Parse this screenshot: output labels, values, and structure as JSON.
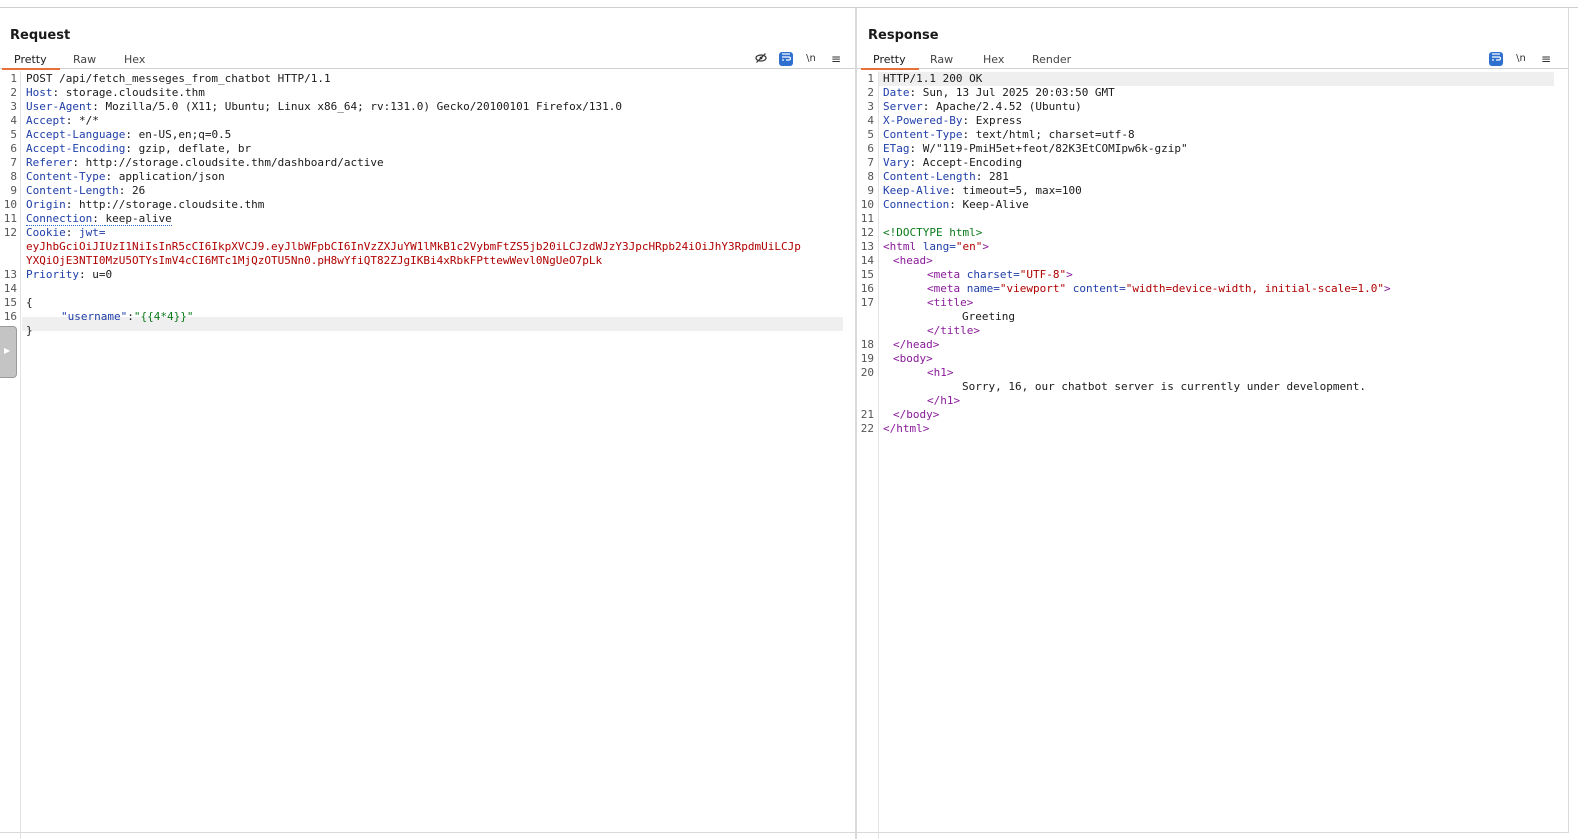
{
  "request": {
    "title": "Request",
    "tabs": [
      "Pretty",
      "Raw",
      "Hex"
    ],
    "line_numbers": [
      "1",
      "2",
      "3",
      "4",
      "5",
      "6",
      "7",
      "8",
      "9",
      "10",
      "11",
      "12",
      "13",
      "14",
      "15",
      "16"
    ],
    "request_line": "POST /api/fetch_messeges_from_chatbot HTTP/1.1",
    "headers": [
      {
        "name": "Host",
        "value": "storage.cloudsite.thm"
      },
      {
        "name": "User-Agent",
        "value": "Mozilla/5.0 (X11; Ubuntu; Linux x86_64; rv:131.0) Gecko/20100101 Firefox/131.0"
      },
      {
        "name": "Accept",
        "value": "*/*"
      },
      {
        "name": "Accept-Language",
        "value": "en-US,en;q=0.5"
      },
      {
        "name": "Accept-Encoding",
        "value": "gzip, deflate, br"
      },
      {
        "name": "Referer",
        "value": "http://storage.cloudsite.thm/dashboard/active"
      },
      {
        "name": "Content-Type",
        "value": "application/json"
      },
      {
        "name": "Content-Length",
        "value": "26"
      },
      {
        "name": "Origin",
        "value": "http://storage.cloudsite.thm"
      },
      {
        "name": "Connection",
        "value": "keep-alive"
      }
    ],
    "cookie_name": "Cookie",
    "cookie_key": "jwt=",
    "cookie_line1": "eyJhbGciOiJIUzI1NiIsInR5cCI6IkpXVCJ9.eyJlbWFpbCI6InVzZXJuYW1lMkB1c2VybmFtZS5jb20iLCJzdWJzY3JpcHRpb24iOiJhY3RpdmUiLCJp",
    "cookie_line2": "YXQiOjE3NTI0MzU5OTYsImV4cCI6MTc1MjQzOTU5Nn0.pH8wYfiQT82ZJgIKBi4xRbkFPttewWevl0NgUeO7pLk",
    "priority_name": "Priority",
    "priority_value": "u=0",
    "body_open": "{",
    "body_key": "\"username\"",
    "body_colon": ":",
    "body_value": "\"{{4*4}}\"",
    "body_close": "}"
  },
  "response": {
    "title": "Response",
    "tabs": [
      "Pretty",
      "Raw",
      "Hex",
      "Render"
    ],
    "line_numbers": [
      "1",
      "2",
      "3",
      "4",
      "5",
      "6",
      "7",
      "8",
      "9",
      "10",
      "11",
      "12",
      "13",
      "14",
      "15",
      "16",
      "17",
      "18",
      "19",
      "20",
      "21",
      "22"
    ],
    "status_line": "HTTP/1.1 200 OK",
    "headers": [
      {
        "name": "Date",
        "value": "Sun, 13 Jul 2025 20:03:50 GMT"
      },
      {
        "name": "Server",
        "value": "Apache/2.4.52 (Ubuntu)"
      },
      {
        "name": "X-Powered-By",
        "value": "Express"
      },
      {
        "name": "Content-Type",
        "value": "text/html; charset=utf-8"
      },
      {
        "name": "ETag",
        "value": "W/\"119-PmiH5et+feot/82K3EtCOMIpw6k-gzip\""
      },
      {
        "name": "Vary",
        "value": "Accept-Encoding"
      },
      {
        "name": "Content-Length",
        "value": "281"
      },
      {
        "name": "Keep-Alive",
        "value": "timeout=5, max=100"
      },
      {
        "name": "Connection",
        "value": "Keep-Alive"
      }
    ],
    "html": {
      "doctype": "<!DOCTYPE html>",
      "html_open_tag": "<html",
      "lang_attr": "lang=",
      "lang_val": "\"en\"",
      "close_gt": ">",
      "head_open": "<head>",
      "meta_tag": "<meta",
      "charset_attr": "charset=",
      "charset_val": "\"UTF-8\"",
      "name_attr": "name=",
      "name_val": "\"viewport\"",
      "content_attr": "content=",
      "content_val": "\"width=device-width, initial-scale=1.0\"",
      "title_open": "<title>",
      "title_text": "Greeting",
      "title_close": "</title>",
      "head_close": "</head>",
      "body_open": "<body>",
      "h1_open": "<h1>",
      "h1_text": "Sorry, 16, our chatbot server is currently under development.",
      "h1_close": "</h1>",
      "body_close": "</body>",
      "html_close": "</html>"
    }
  },
  "toolbar_icons": {
    "hide": "eye-off-icon",
    "wrap": "word-wrap-icon",
    "newline": "\\n",
    "menu": "≡"
  },
  "colors": {
    "accent_tab": "#e8703a",
    "header_name": "#1f3ea8",
    "string_value": "#b00000",
    "json_value": "#0a7a1a",
    "html_tag": "#8a1a9a",
    "toggle_active": "#2f6fcf"
  }
}
